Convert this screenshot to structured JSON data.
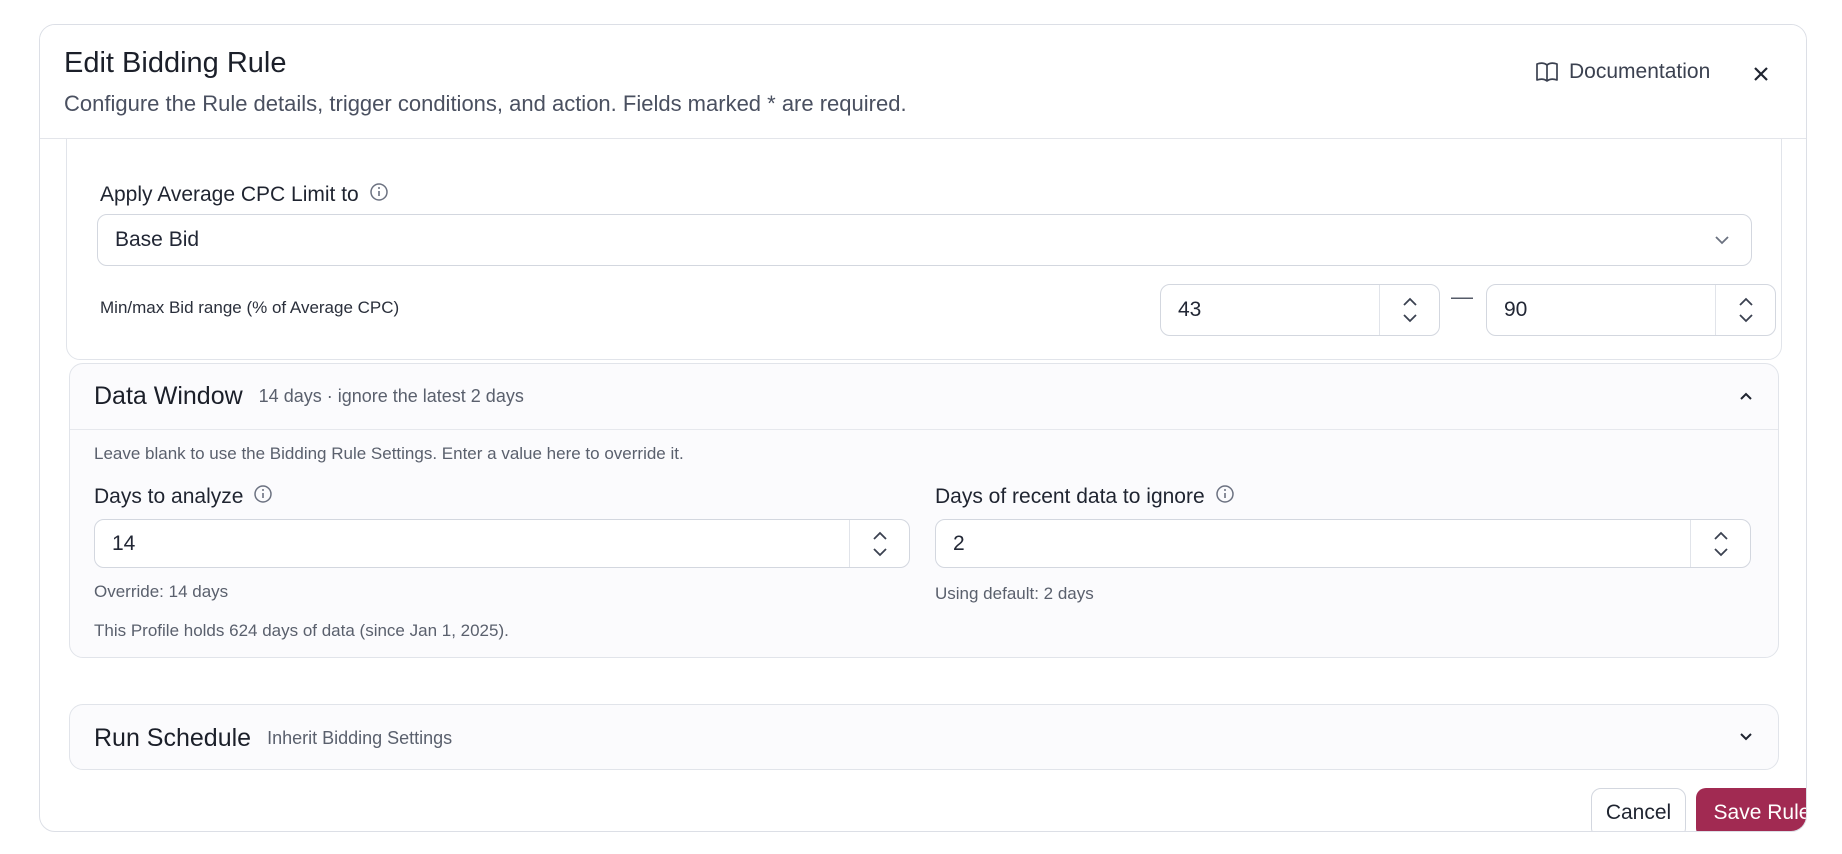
{
  "modal": {
    "title": "Edit Bidding Rule",
    "subtitle": "Configure the Rule details, trigger conditions, and action. Fields marked * are required.",
    "documentation_label": "Documentation"
  },
  "cpc_limit": {
    "label": "Apply Average CPC Limit to",
    "selected": "Base Bid",
    "range_label": "Min/max Bid range (% of Average CPC)",
    "min_value": "43",
    "separator": "—",
    "max_value": "90"
  },
  "data_window": {
    "title": "Data Window",
    "summary": "14 days · ignore the latest 2 days",
    "hint": "Leave blank to use the Bidding Rule Settings. Enter a value here to override it.",
    "days_to_analyze": {
      "label": "Days to analyze",
      "value": "14",
      "help": "Override: 14 days"
    },
    "days_to_ignore": {
      "label": "Days of recent data to ignore",
      "value": "2",
      "help": "Using default: 2 days"
    },
    "profile_note": "This Profile holds 624 days of data (since Jan 1, 2025)."
  },
  "run_schedule": {
    "title": "Run Schedule",
    "summary": "Inherit Bidding Settings"
  },
  "footer": {
    "cancel_label": "Cancel",
    "save_label": "Save Rule"
  },
  "colors": {
    "primary": "#a12a52",
    "border": "#d3d7df"
  }
}
